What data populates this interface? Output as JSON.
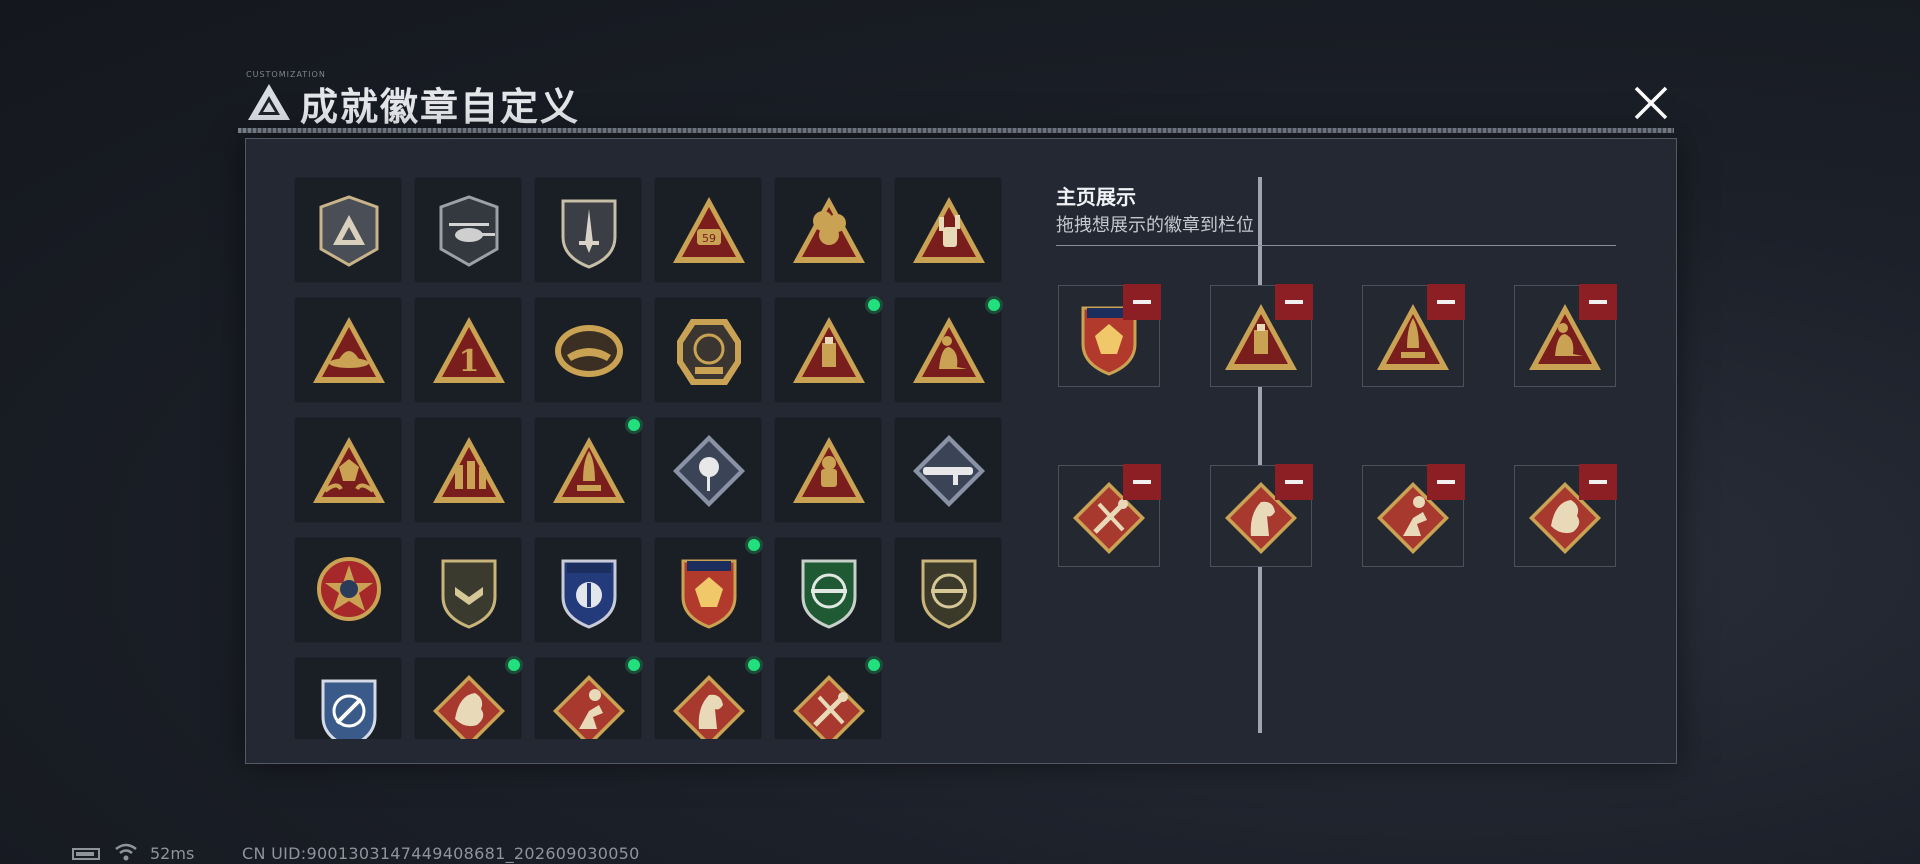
{
  "header": {
    "title": "成就徽章自定义",
    "subtitle_small": "CUSTOMIZATION",
    "logo_icon": "delta-triangle-logo-icon",
    "close_icon": "close-x-icon"
  },
  "colors": {
    "panel_bg": "#232833",
    "cell_bg": "#1a1e25",
    "gold": "#c9a253",
    "badge_red": "#7a1d1d",
    "new_dot": "#21e07d",
    "remove_button": "#8c1f24"
  },
  "badge_grid": {
    "items": [
      {
        "icon": "delta-shield-emblem-icon",
        "new": false
      },
      {
        "icon": "helicopter-shield-badge-icon",
        "new": false
      },
      {
        "icon": "dagger-shield-badge-icon",
        "new": false
      },
      {
        "icon": "gold-triangle-59-badge-icon",
        "new": false
      },
      {
        "icon": "gold-flower-triangle-badge-icon",
        "new": false
      },
      {
        "icon": "rock-hand-triangle-badge-icon",
        "new": false
      },
      {
        "icon": "hat-triangle-badge-icon",
        "new": false
      },
      {
        "icon": "number-one-triangle-badge-icon",
        "new": false
      },
      {
        "icon": "delta-force-crest-badge-icon",
        "new": false
      },
      {
        "icon": "delta-force-2026-badge-icon",
        "new": false
      },
      {
        "icon": "usb-drive-triangle-badge-icon",
        "new": true
      },
      {
        "icon": "seated-figure-triangle-badge-icon",
        "new": true
      },
      {
        "icon": "dice-hands-triangle-badge-icon",
        "new": false
      },
      {
        "icon": "soldiers-triangle-badge-icon",
        "new": false
      },
      {
        "icon": "rocket-triangle-badge-icon",
        "new": true
      },
      {
        "icon": "rose-diamond-badge-icon",
        "new": false
      },
      {
        "icon": "astronaut-triangle-badge-icon",
        "new": false
      },
      {
        "icon": "launcher-diamond-badge-icon",
        "new": false
      },
      {
        "icon": "star-medal-badge-icon",
        "new": false
      },
      {
        "icon": "chevron-shield-badge-icon",
        "new": false
      },
      {
        "icon": "blue-wing-shield-badge-icon",
        "new": false
      },
      {
        "icon": "red-gem-shield-badge-icon",
        "new": true
      },
      {
        "icon": "green-rifle-shield-badge-icon",
        "new": false
      },
      {
        "icon": "rifle-circle-shield-badge-icon",
        "new": false
      },
      {
        "icon": "blue-target-shield-badge-icon",
        "new": false
      },
      {
        "icon": "dragon-diamond-badge-icon",
        "new": true
      },
      {
        "icon": "runner-diamond-badge-icon",
        "new": true
      },
      {
        "icon": "horse-diamond-badge-icon",
        "new": true
      },
      {
        "icon": "tools-diamond-badge-icon",
        "new": true
      }
    ]
  },
  "showcase": {
    "title": "主页展示",
    "instruction": "拖拽想展示的徽章到栏位",
    "remove_icon": "minus-icon",
    "slots": [
      {
        "icon": "red-gem-shield-badge-icon"
      },
      {
        "icon": "usb-drive-triangle-badge-icon"
      },
      {
        "icon": "rocket-triangle-badge-icon"
      },
      {
        "icon": "seated-figure-triangle-badge-icon"
      },
      {
        "icon": "tools-diamond-badge-icon"
      },
      {
        "icon": "horse-diamond-badge-icon"
      },
      {
        "icon": "runner-diamond-badge-icon"
      },
      {
        "icon": "dragon-diamond-badge-icon"
      }
    ]
  },
  "status_bar": {
    "battery_icon": "battery-icon",
    "wifi_icon": "wifi-icon",
    "ping": "52ms",
    "uid": "CN UID:9001303147449408681_202609030050"
  }
}
